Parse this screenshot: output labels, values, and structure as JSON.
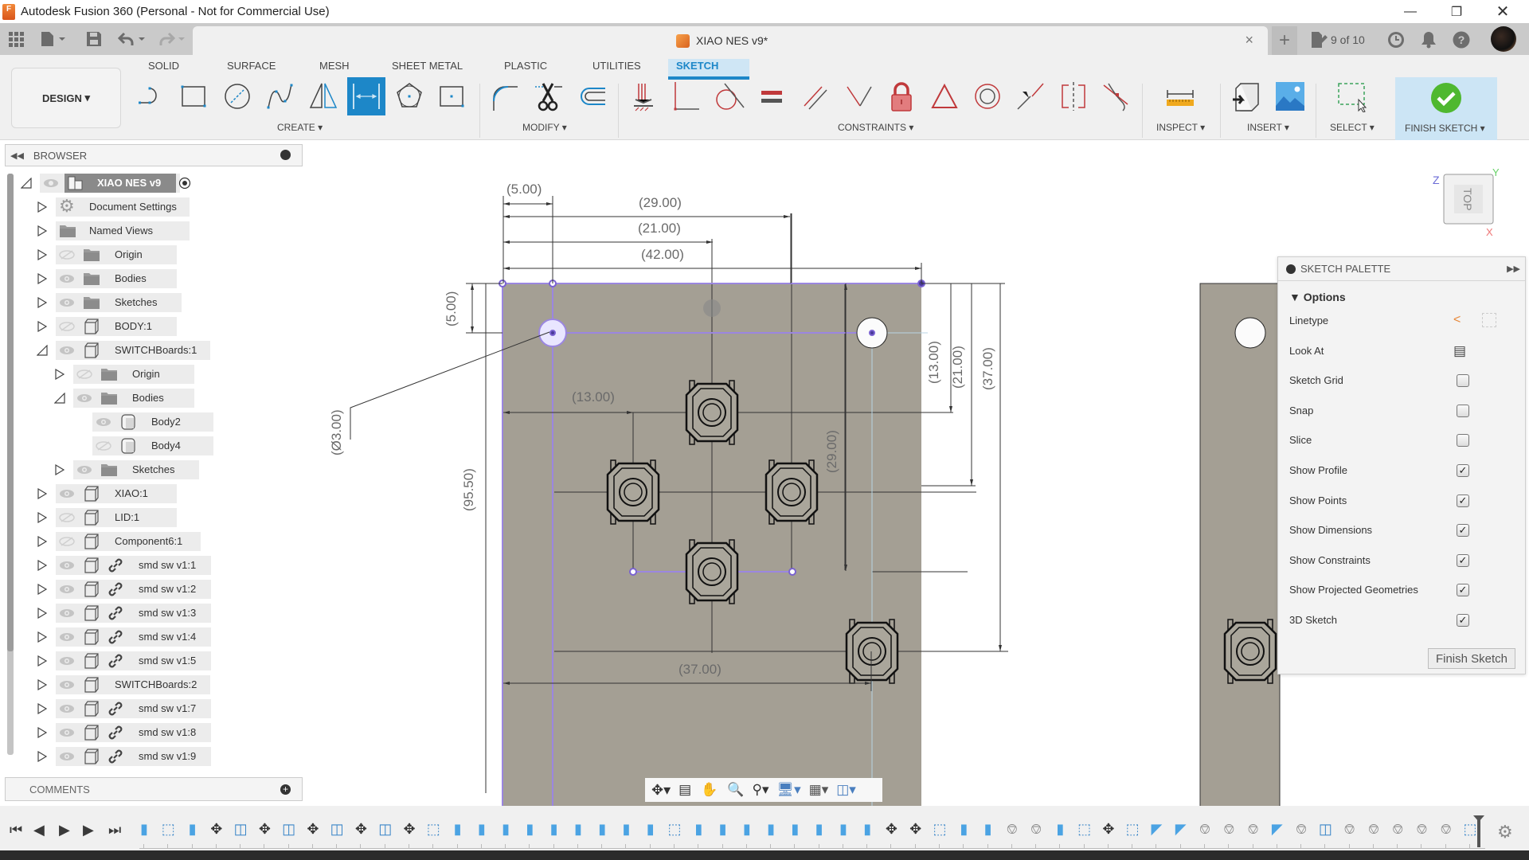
{
  "window": {
    "title": "Autodesk Fusion 360 (Personal - Not for Commercial Use)",
    "app_icon_letter": "F",
    "controls": [
      "minimize",
      "restore",
      "close"
    ]
  },
  "tabbar": {
    "document_tab": "XIAO NES v9*",
    "job_status": "9 of 10",
    "icons": [
      "grid-apps-icon",
      "file-icon",
      "save-icon",
      "undo-icon",
      "redo-icon",
      "new-tab-icon",
      "job-status-icon",
      "history-icon",
      "notification-bell-icon",
      "help-icon",
      "avatar"
    ]
  },
  "ribbon": {
    "workspace": "DESIGN",
    "tabs": [
      {
        "label": "SOLID",
        "active": false
      },
      {
        "label": "SURFACE",
        "active": false
      },
      {
        "label": "MESH",
        "active": false
      },
      {
        "label": "SHEET METAL",
        "active": false
      },
      {
        "label": "PLASTIC",
        "active": false
      },
      {
        "label": "UTILITIES",
        "active": false
      },
      {
        "label": "SKETCH",
        "active": true
      }
    ],
    "groups": {
      "create": "CREATE",
      "modify": "MODIFY",
      "constraints": "CONSTRAINTS",
      "inspect": "INSPECT",
      "insert": "INSERT",
      "select": "SELECT",
      "finish": "FINISH SKETCH"
    },
    "create_tools": [
      "line",
      "rectangle",
      "circle",
      "spline",
      "mirror",
      "sketch-dimension",
      "polygon",
      "point"
    ],
    "modify_tools": [
      "fillet",
      "trim",
      "offset"
    ],
    "constraint_tools": [
      "fix",
      "coincident",
      "tangent",
      "equal",
      "parallel",
      "perpendicular",
      "horizontal-vertical",
      "midpoint",
      "concentric",
      "collinear",
      "symmetric",
      "curvature"
    ],
    "accent_color": "#1d87c8",
    "finish_color": "#4fb830"
  },
  "browser": {
    "title": "BROWSER",
    "root": "XIAO NES v9",
    "items": [
      {
        "label": "Document Settings",
        "depth": 1,
        "expanded": false,
        "visible": null,
        "icon": "gear",
        "link": false
      },
      {
        "label": "Named Views",
        "depth": 1,
        "expanded": false,
        "visible": null,
        "icon": "folder",
        "link": false
      },
      {
        "label": "Origin",
        "depth": 1,
        "expanded": false,
        "visible": false,
        "icon": "folder",
        "link": false
      },
      {
        "label": "Bodies",
        "depth": 1,
        "expanded": false,
        "visible": true,
        "icon": "folder",
        "link": false
      },
      {
        "label": "Sketches",
        "depth": 1,
        "expanded": false,
        "visible": true,
        "icon": "folder",
        "link": false
      },
      {
        "label": "BODY:1",
        "depth": 1,
        "expanded": false,
        "visible": false,
        "icon": "component",
        "link": false
      },
      {
        "label": "SWITCHBoards:1",
        "depth": 1,
        "expanded": true,
        "visible": true,
        "icon": "component",
        "link": false
      },
      {
        "label": "Origin",
        "depth": 2,
        "expanded": false,
        "visible": false,
        "icon": "folder",
        "link": false
      },
      {
        "label": "Bodies",
        "depth": 2,
        "expanded": true,
        "visible": true,
        "icon": "folder",
        "link": false
      },
      {
        "label": "Body2",
        "depth": 3,
        "expanded": null,
        "visible": true,
        "icon": "body",
        "link": false
      },
      {
        "label": "Body4",
        "depth": 3,
        "expanded": null,
        "visible": false,
        "icon": "body",
        "link": false
      },
      {
        "label": "Sketches",
        "depth": 2,
        "expanded": false,
        "visible": true,
        "icon": "folder",
        "link": false
      },
      {
        "label": "XIAO:1",
        "depth": 1,
        "expanded": false,
        "visible": true,
        "icon": "component",
        "link": false
      },
      {
        "label": "LID:1",
        "depth": 1,
        "expanded": false,
        "visible": false,
        "icon": "component",
        "link": false
      },
      {
        "label": "Component6:1",
        "depth": 1,
        "expanded": false,
        "visible": false,
        "icon": "component",
        "link": false
      },
      {
        "label": "smd sw v1:1",
        "depth": 1,
        "expanded": false,
        "visible": true,
        "icon": "component",
        "link": true
      },
      {
        "label": "smd sw v1:2",
        "depth": 1,
        "expanded": false,
        "visible": true,
        "icon": "component",
        "link": true
      },
      {
        "label": "smd sw v1:3",
        "depth": 1,
        "expanded": false,
        "visible": true,
        "icon": "component",
        "link": true
      },
      {
        "label": "smd sw v1:4",
        "depth": 1,
        "expanded": false,
        "visible": true,
        "icon": "component",
        "link": true
      },
      {
        "label": "smd sw v1:5",
        "depth": 1,
        "expanded": false,
        "visible": true,
        "icon": "component",
        "link": true
      },
      {
        "label": "SWITCHBoards:2",
        "depth": 1,
        "expanded": false,
        "visible": true,
        "icon": "component",
        "link": false
      },
      {
        "label": "smd sw v1:7",
        "depth": 1,
        "expanded": false,
        "visible": true,
        "icon": "component",
        "link": true
      },
      {
        "label": "smd sw v1:8",
        "depth": 1,
        "expanded": false,
        "visible": true,
        "icon": "component",
        "link": true
      },
      {
        "label": "smd sw v1:9",
        "depth": 1,
        "expanded": false,
        "visible": true,
        "icon": "component",
        "link": true
      }
    ],
    "comments_title": "COMMENTS"
  },
  "viewcube": {
    "face": "TOP",
    "axes": {
      "z": "Z",
      "y": "Y",
      "x": "X"
    }
  },
  "sketch": {
    "dimensions": {
      "d_5_top": "(5.00)",
      "d_29": "(29.00)",
      "d_21": "(21.00)",
      "d_42": "(42.00)",
      "d_5_left": "(5.00)",
      "d_dia3": "(Ø3.00)",
      "d_13_h": "(13.00)",
      "d_95_5": "(95.50)",
      "d_29_v": "(29.00)",
      "d_13_v": "(13.00)",
      "d_21_v": "(21.00)",
      "d_37_v": "(37.00)",
      "d_37_h": "(37.00)"
    },
    "board_color": "#a49f94",
    "sketch_line_color": "#9b86e0"
  },
  "palette": {
    "title": "SKETCH PALETTE",
    "section": "Options",
    "rows": [
      {
        "label": "Linetype",
        "type": "icons"
      },
      {
        "label": "Look At",
        "type": "icon"
      },
      {
        "label": "Sketch Grid",
        "type": "checkbox",
        "checked": false
      },
      {
        "label": "Snap",
        "type": "checkbox",
        "checked": false
      },
      {
        "label": "Slice",
        "type": "checkbox",
        "checked": false
      },
      {
        "label": "Show Profile",
        "type": "checkbox",
        "checked": true
      },
      {
        "label": "Show Points",
        "type": "checkbox",
        "checked": true
      },
      {
        "label": "Show Dimensions",
        "type": "checkbox",
        "checked": true
      },
      {
        "label": "Show Constraints",
        "type": "checkbox",
        "checked": true
      },
      {
        "label": "Show Projected Geometries",
        "type": "checkbox",
        "checked": true
      },
      {
        "label": "3D Sketch",
        "type": "checkbox",
        "checked": true
      }
    ],
    "finish_button": "Finish Sketch"
  },
  "navbar": {
    "tools": [
      "orbit-icon",
      "look-at-icon",
      "pan-icon",
      "zoom-icon",
      "fit-icon",
      "display-settings-icon",
      "grid-settings-icon",
      "viewports-icon"
    ]
  },
  "timeline": {
    "controls": [
      "go-to-start",
      "step-back",
      "play",
      "step-forward",
      "go-to-end"
    ],
    "features": [
      "extrude",
      "sketch",
      "extrude",
      "move",
      "joint",
      "move",
      "joint",
      "move",
      "joint",
      "move",
      "joint",
      "move",
      "sketch",
      "extrude",
      "extrude",
      "extrude",
      "extrude",
      "extrude",
      "extrude",
      "extrude",
      "extrude",
      "extrude",
      "sketch",
      "extrude",
      "extrude",
      "extrude",
      "extrude",
      "extrude",
      "extrude",
      "extrude",
      "extrude",
      "move",
      "move",
      "sketch",
      "extrude",
      "extrude",
      "rigid-group",
      "rigid-group",
      "extrude",
      "sketch",
      "move",
      "sketch",
      "flange",
      "flange",
      "rigid-group",
      "rigid-group",
      "rigid-group",
      "flange",
      "rigid-group",
      "joint",
      "rigid-group",
      "rigid-group",
      "rigid-group",
      "rigid-group",
      "rigid-group",
      "sketch"
    ]
  }
}
